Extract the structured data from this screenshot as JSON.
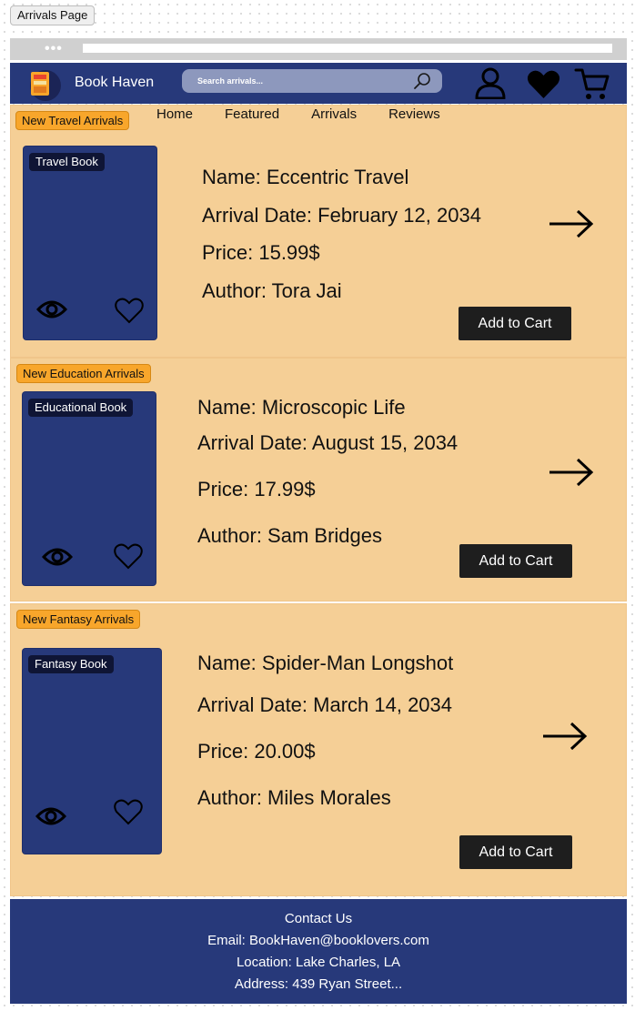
{
  "frame_label": "Arrivals Page",
  "browser": {
    "dots": "•••"
  },
  "header": {
    "brand": "Book Haven",
    "search_placeholder": "Search arrivals..."
  },
  "nav": {
    "items": [
      "Home",
      "Featured",
      "Arrivals",
      "Reviews"
    ]
  },
  "sections": [
    {
      "badge": "New Travel Arrivals",
      "cover_label": "Travel Book",
      "name": "Name: Eccentric Travel",
      "date": "Arrival Date: February 12, 2034",
      "price": "Price: 15.99$",
      "author": "Author: Tora Jai",
      "button": "Add to Cart"
    },
    {
      "badge": "New Education Arrivals",
      "cover_label": "Educational Book",
      "name": "Name: Microscopic Life",
      "date": "Arrival Date: August 15, 2034",
      "price": "Price: 17.99$",
      "author": "Author: Sam Bridges",
      "button": "Add to Cart"
    },
    {
      "badge": "New Fantasy Arrivals",
      "cover_label": "Fantasy Book",
      "name": "Name: Spider-Man Longshot",
      "date": "Arrival Date: March 14, 2034",
      "price": "Price: 20.00$",
      "author": "Author: Miles Morales",
      "button": "Add to Cart"
    }
  ],
  "footer": {
    "title": "Contact Us",
    "email": "Email: BookHaven@booklovers.com",
    "location": "Location: Lake Charles, LA",
    "address": "Address: 439 Ryan Street..."
  },
  "colors": {
    "header_bg": "#27397a",
    "section_bg": "#f5cf96",
    "badge_bg": "#f8a62b",
    "button_bg": "#1e1e1e"
  },
  "icons": [
    "book-logo-icon",
    "search-icon",
    "user-icon",
    "heart-icon",
    "cart-icon",
    "eye-icon",
    "arrow-right-icon"
  ]
}
